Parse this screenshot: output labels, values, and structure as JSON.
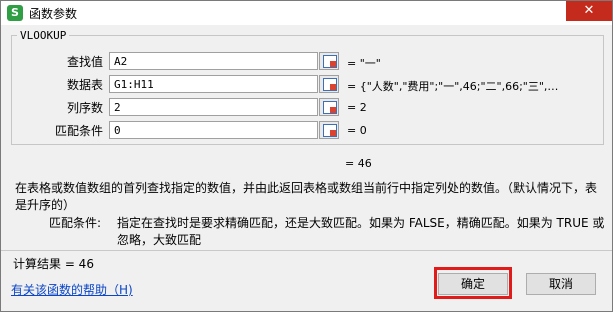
{
  "window": {
    "icon_text": "S",
    "title": "函数参数",
    "close": "✕"
  },
  "group_label": "VLOOKUP",
  "fields": [
    {
      "label": "查找值",
      "value": "A2",
      "result": "= \"一\""
    },
    {
      "label": "数据表",
      "value": "G1:H11",
      "result": "= {\"人数\",\"费用\";\"一\",46;\"二\",66;\"三\",…"
    },
    {
      "label": "列序数",
      "value": "2",
      "result": "= 2"
    },
    {
      "label": "匹配条件",
      "value": "0",
      "result": "= 0"
    }
  ],
  "formula_result": "= 46",
  "description": "在表格或数值数组的首列查找指定的数值，并由此返回表格或数组当前行中指定列处的数值。（默认情况下，表是升序的）",
  "param_help": {
    "name": "匹配条件:",
    "text": "指定在查找时是要求精确匹配，还是大致匹配。如果为 FALSE，精确匹配。如果为 TRUE 或忽略，大致匹配"
  },
  "calc_result": "计算结果 = 46",
  "help_link": "有关该函数的帮助（H)",
  "buttons": {
    "ok": "确定",
    "cancel": "取消"
  },
  "colors": {
    "close": "#c42b1c",
    "highlight": "#e11a1a",
    "link": "#0b46c8"
  }
}
